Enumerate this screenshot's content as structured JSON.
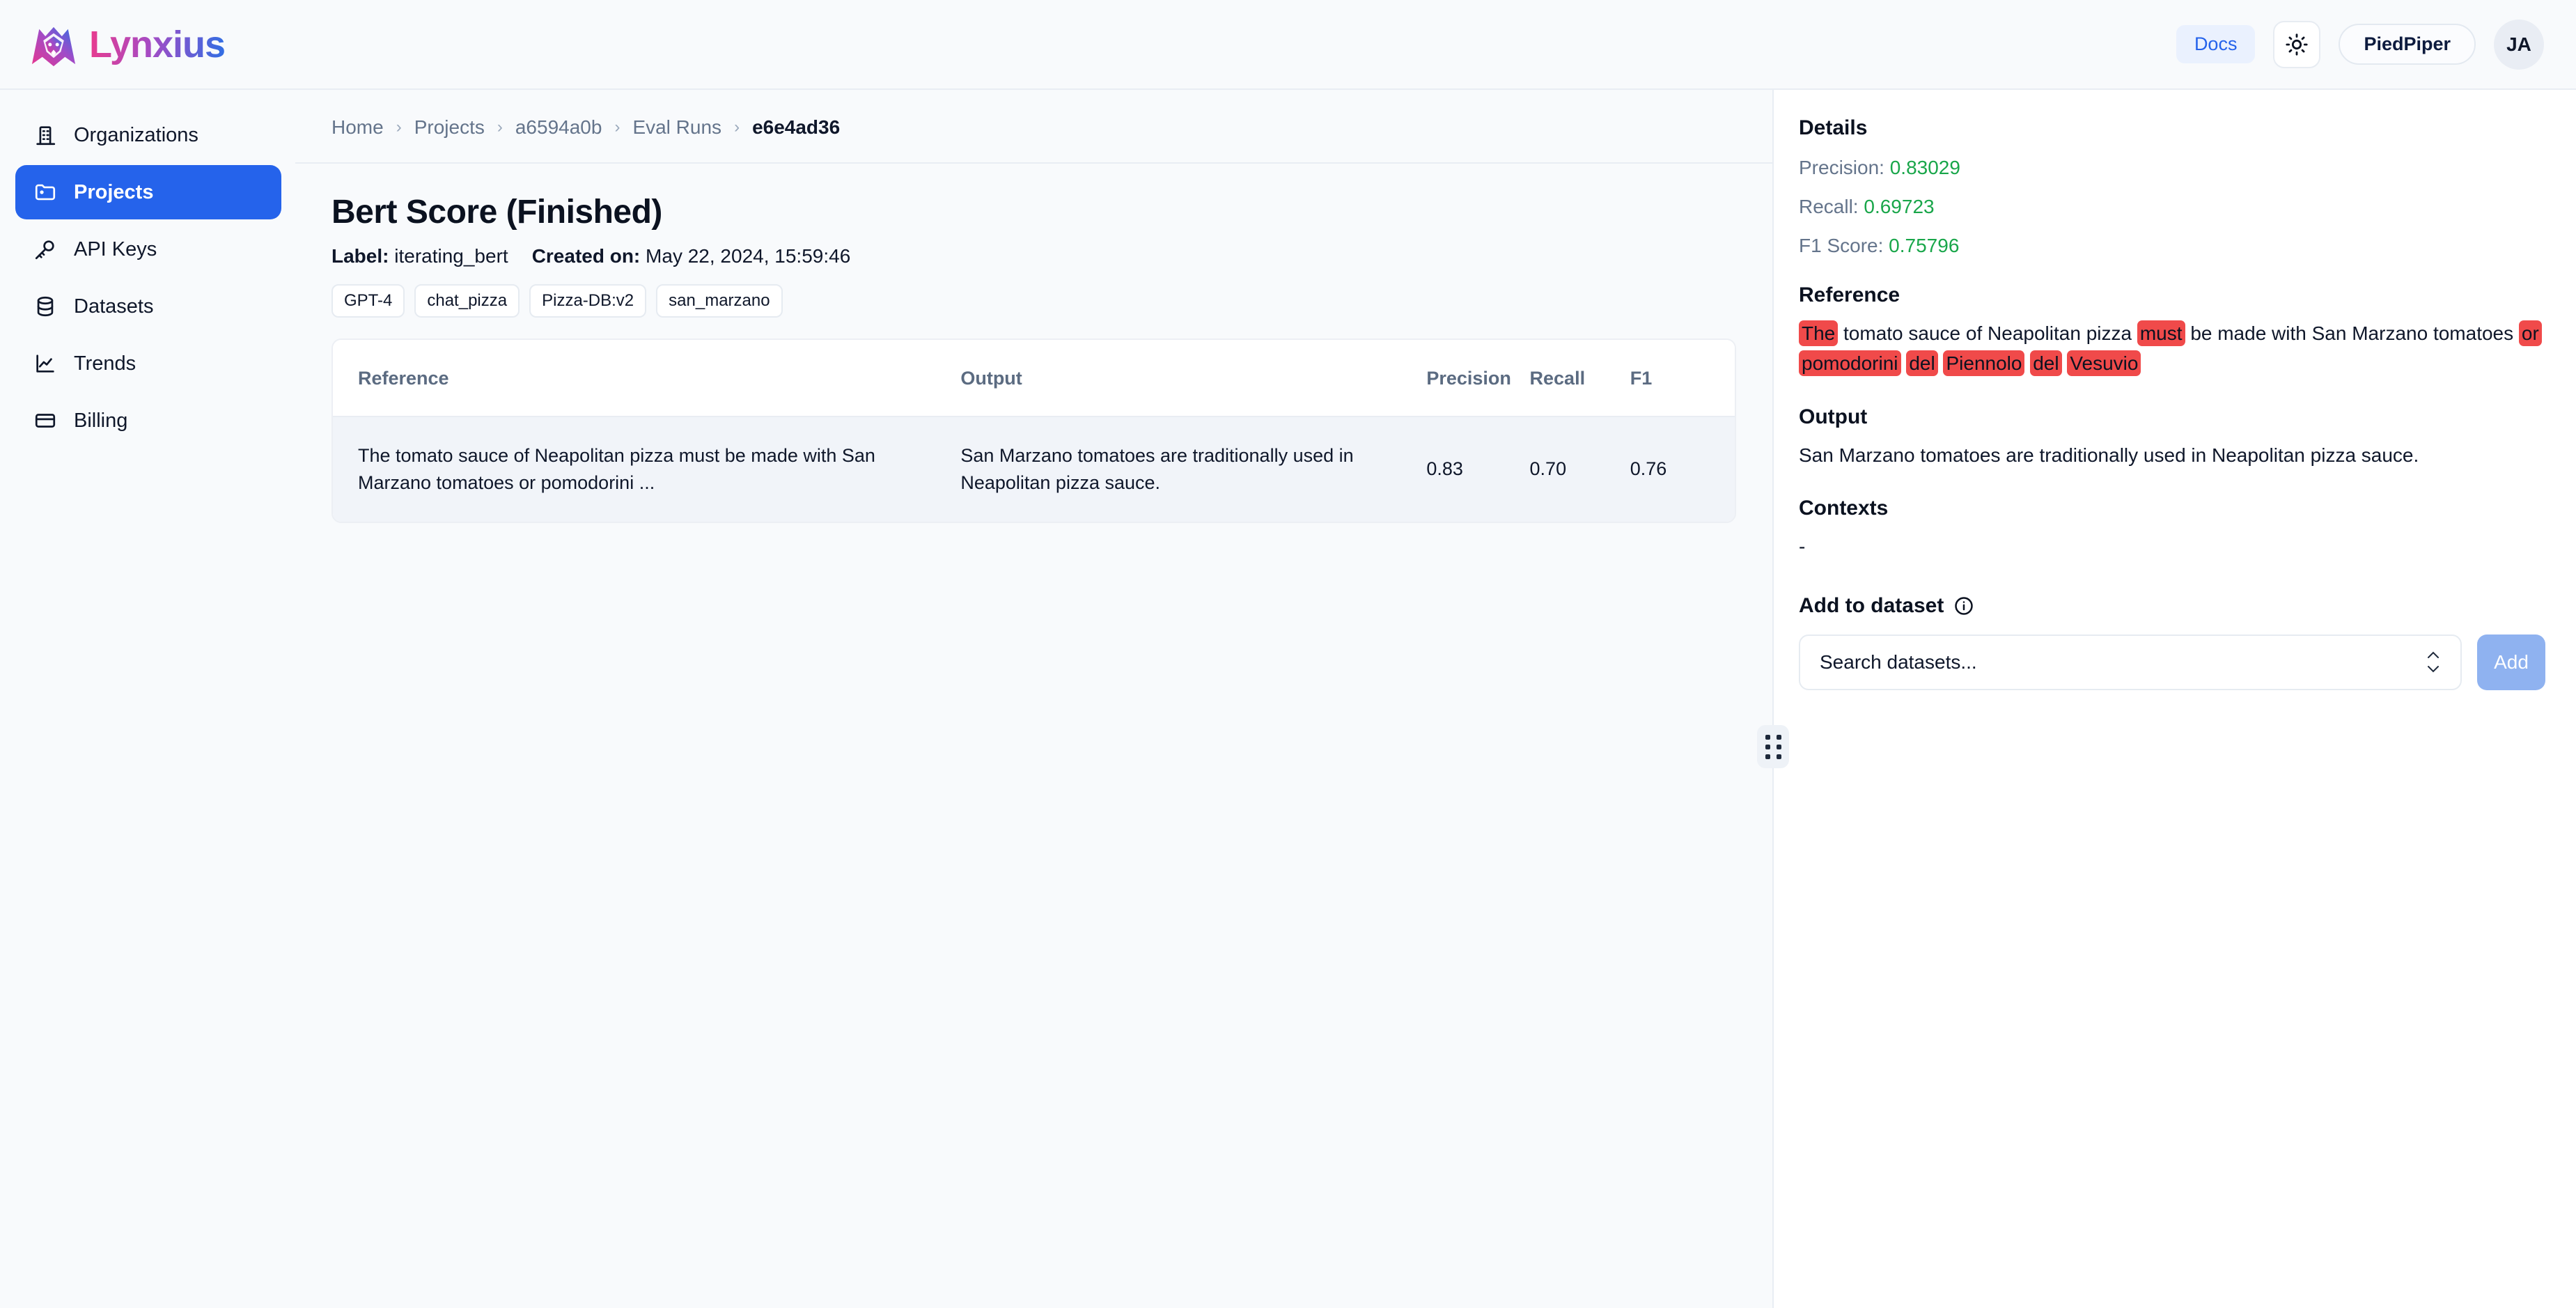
{
  "header": {
    "brand_name": "Lynxius",
    "docs_label": "Docs",
    "theme_icon": "sun-icon",
    "org_label": "PiedPiper",
    "avatar_initials": "JA"
  },
  "sidebar": {
    "items": [
      {
        "label": "Organizations",
        "icon": "building-icon",
        "active": false
      },
      {
        "label": "Projects",
        "icon": "folder-icon",
        "active": true
      },
      {
        "label": "API Keys",
        "icon": "key-icon",
        "active": false
      },
      {
        "label": "Datasets",
        "icon": "database-icon",
        "active": false
      },
      {
        "label": "Trends",
        "icon": "line-chart-icon",
        "active": false
      },
      {
        "label": "Billing",
        "icon": "credit-card-icon",
        "active": false
      }
    ]
  },
  "breadcrumb": {
    "items": [
      "Home",
      "Projects",
      "a6594a0b",
      "Eval Runs"
    ],
    "current": "e6e4ad36",
    "separator": "›"
  },
  "main": {
    "title": "Bert Score (Finished)",
    "label_key": "Label:",
    "label_value": "iterating_bert",
    "created_key": "Created on:",
    "created_value": "May 22, 2024, 15:59:46",
    "tags": [
      "GPT-4",
      "chat_pizza",
      "Pizza-DB:v2",
      "san_marzano"
    ],
    "table": {
      "columns": [
        "Reference",
        "Output",
        "Precision",
        "Recall",
        "F1"
      ],
      "rows": [
        {
          "reference": "The tomato sauce of Neapolitan pizza must be made with San Marzano tomatoes or pomodorini ...",
          "output": "San Marzano tomatoes are traditionally used in Neapolitan pizza sauce.",
          "precision": "0.83",
          "recall": "0.70",
          "f1": "0.76"
        }
      ]
    }
  },
  "panel": {
    "details_title": "Details",
    "precision_key": "Precision:",
    "precision_value": "0.83029",
    "recall_key": "Recall:",
    "recall_value": "0.69723",
    "f1_key": "F1 Score:",
    "f1_value": "0.75796",
    "reference_title": "Reference",
    "reference_tokens": [
      {
        "text": "The",
        "highlight": true
      },
      {
        "text": "tomato sauce of Neapolitan pizza",
        "highlight": false
      },
      {
        "text": "must",
        "highlight": true
      },
      {
        "text": "be made with San Marzano tomatoes",
        "highlight": false
      },
      {
        "text": "or",
        "highlight": true
      },
      {
        "text": "pomodorini",
        "highlight": true
      },
      {
        "text": "del",
        "highlight": true
      },
      {
        "text": "Piennolo",
        "highlight": true
      },
      {
        "text": "del",
        "highlight": true
      },
      {
        "text": "Vesuvio",
        "highlight": true
      }
    ],
    "output_title": "Output",
    "output_text": "San Marzano tomatoes are traditionally used in Neapolitan pizza sauce.",
    "contexts_title": "Contexts",
    "contexts_text": "-",
    "add_title": "Add to dataset",
    "add_info_icon": "info-icon",
    "select_placeholder": "Search datasets...",
    "add_button": "Add"
  },
  "colors": {
    "accent": "#2563eb",
    "docs_text": "#2563eb",
    "docs_bg": "#eaf1fe",
    "score_green": "#19a64a",
    "highlight_red": "#f04a4a",
    "add_button": "#8fb2f0",
    "page_bg": "#f8fafc",
    "row_bg": "#f1f4f9"
  }
}
